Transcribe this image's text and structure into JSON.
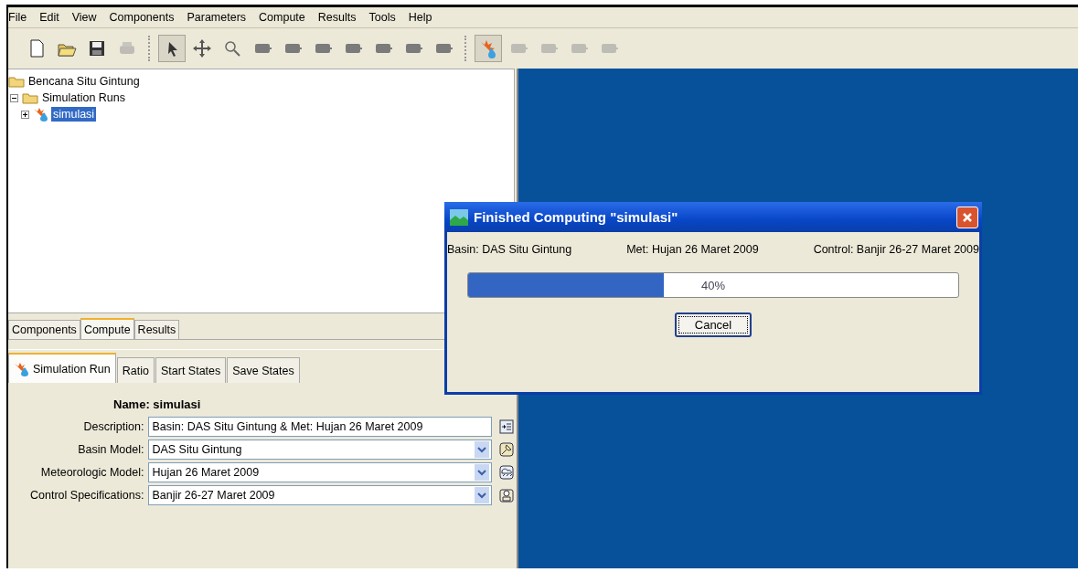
{
  "menu": [
    "File",
    "Edit",
    "View",
    "Components",
    "Parameters",
    "Compute",
    "Results",
    "Tools",
    "Help"
  ],
  "toolbar": [
    {
      "kind": "new",
      "selected": false,
      "disabled": false
    },
    {
      "kind": "open",
      "selected": false,
      "disabled": false
    },
    {
      "kind": "save",
      "selected": false,
      "disabled": false
    },
    {
      "kind": "print",
      "selected": false,
      "disabled": true
    },
    {
      "kind": "sep"
    },
    {
      "kind": "arrow",
      "selected": true,
      "disabled": false
    },
    {
      "kind": "move",
      "selected": false,
      "disabled": false
    },
    {
      "kind": "zoom",
      "selected": false,
      "disabled": false
    },
    {
      "kind": "element",
      "selected": false,
      "disabled": false
    },
    {
      "kind": "element",
      "selected": false,
      "disabled": false
    },
    {
      "kind": "element",
      "selected": false,
      "disabled": false
    },
    {
      "kind": "element",
      "selected": false,
      "disabled": false
    },
    {
      "kind": "element",
      "selected": false,
      "disabled": false
    },
    {
      "kind": "element",
      "selected": false,
      "disabled": false
    },
    {
      "kind": "element",
      "selected": false,
      "disabled": false
    },
    {
      "kind": "sep"
    },
    {
      "kind": "compute",
      "selected": true,
      "disabled": false
    },
    {
      "kind": "element",
      "selected": false,
      "disabled": true
    },
    {
      "kind": "element",
      "selected": false,
      "disabled": true
    },
    {
      "kind": "element",
      "selected": false,
      "disabled": true
    },
    {
      "kind": "element",
      "selected": false,
      "disabled": true
    }
  ],
  "tree": [
    {
      "label": "Bencana Situ Gintung",
      "kind": "folder",
      "selected": false
    },
    {
      "label": "Simulation Runs",
      "kind": "folder",
      "selected": false,
      "expanded": true,
      "children": [
        {
          "label": "simulasi",
          "kind": "run",
          "selected": true,
          "expanded": false
        }
      ]
    }
  ],
  "panel_tabs": [
    {
      "label": "Components",
      "selected": false
    },
    {
      "label": "Compute",
      "selected": true
    },
    {
      "label": "Results",
      "selected": false
    }
  ],
  "sub_tabs": [
    {
      "label": "Simulation Run",
      "selected": true,
      "icon": true
    },
    {
      "label": "Ratio",
      "selected": false,
      "icon": false
    },
    {
      "label": "Start States",
      "selected": false,
      "icon": false
    },
    {
      "label": "Save States",
      "selected": false,
      "icon": false
    }
  ],
  "form": {
    "name": "Name: simulasi",
    "fields": [
      {
        "label": "Description:",
        "value": "Basin: DAS Situ Gintung  & Met: Hujan 26 Maret 2009",
        "kind": "text"
      },
      {
        "label": "Basin Model:",
        "value": "DAS Situ Gintung",
        "kind": "select"
      },
      {
        "label": "Meteorologic Model:",
        "value": "Hujan 26 Maret 2009",
        "kind": "select"
      },
      {
        "label": "Control Specifications:",
        "value": "Banjir 26-27 Maret 2009",
        "kind": "select"
      }
    ]
  },
  "dialog": {
    "title": "Finished Computing \"simulasi\"",
    "info": [
      "Basin: DAS Situ Gintung",
      "Met: Hujan 26 Maret 2009",
      "Control: Banjir 26-27 Maret 2009"
    ],
    "progress": {
      "level": 0.4,
      "reading": "40%"
    },
    "buttons": [
      "Cancel"
    ]
  }
}
